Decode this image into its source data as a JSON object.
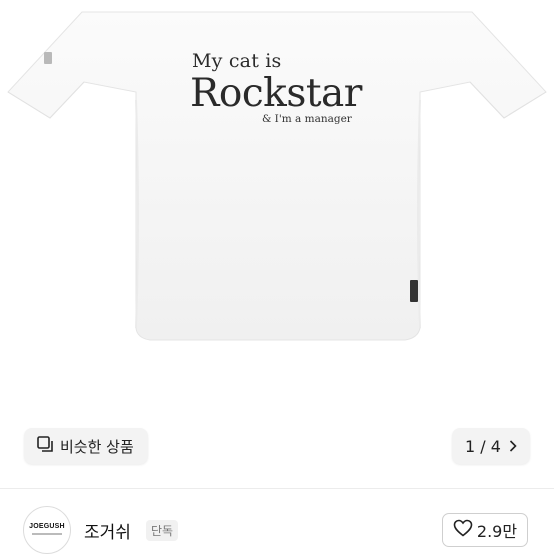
{
  "product_image": {
    "print_line1": "My cat is",
    "print_line2": "Rockstar",
    "print_line3": "& I'm a manager"
  },
  "similar_button": {
    "label": "비슷한 상품",
    "icon": "similar-items-icon"
  },
  "pager": {
    "text": "1 / 4",
    "icon": "chevron-right-icon"
  },
  "seller": {
    "avatar_text": "JOEGUSH",
    "name": "조거쉬",
    "badge": "단독"
  },
  "like": {
    "count": "2.9만",
    "icon": "heart-icon"
  },
  "colors": {
    "shirt": "#f7f7f7",
    "background": "#ffffff",
    "text": "#222222"
  }
}
